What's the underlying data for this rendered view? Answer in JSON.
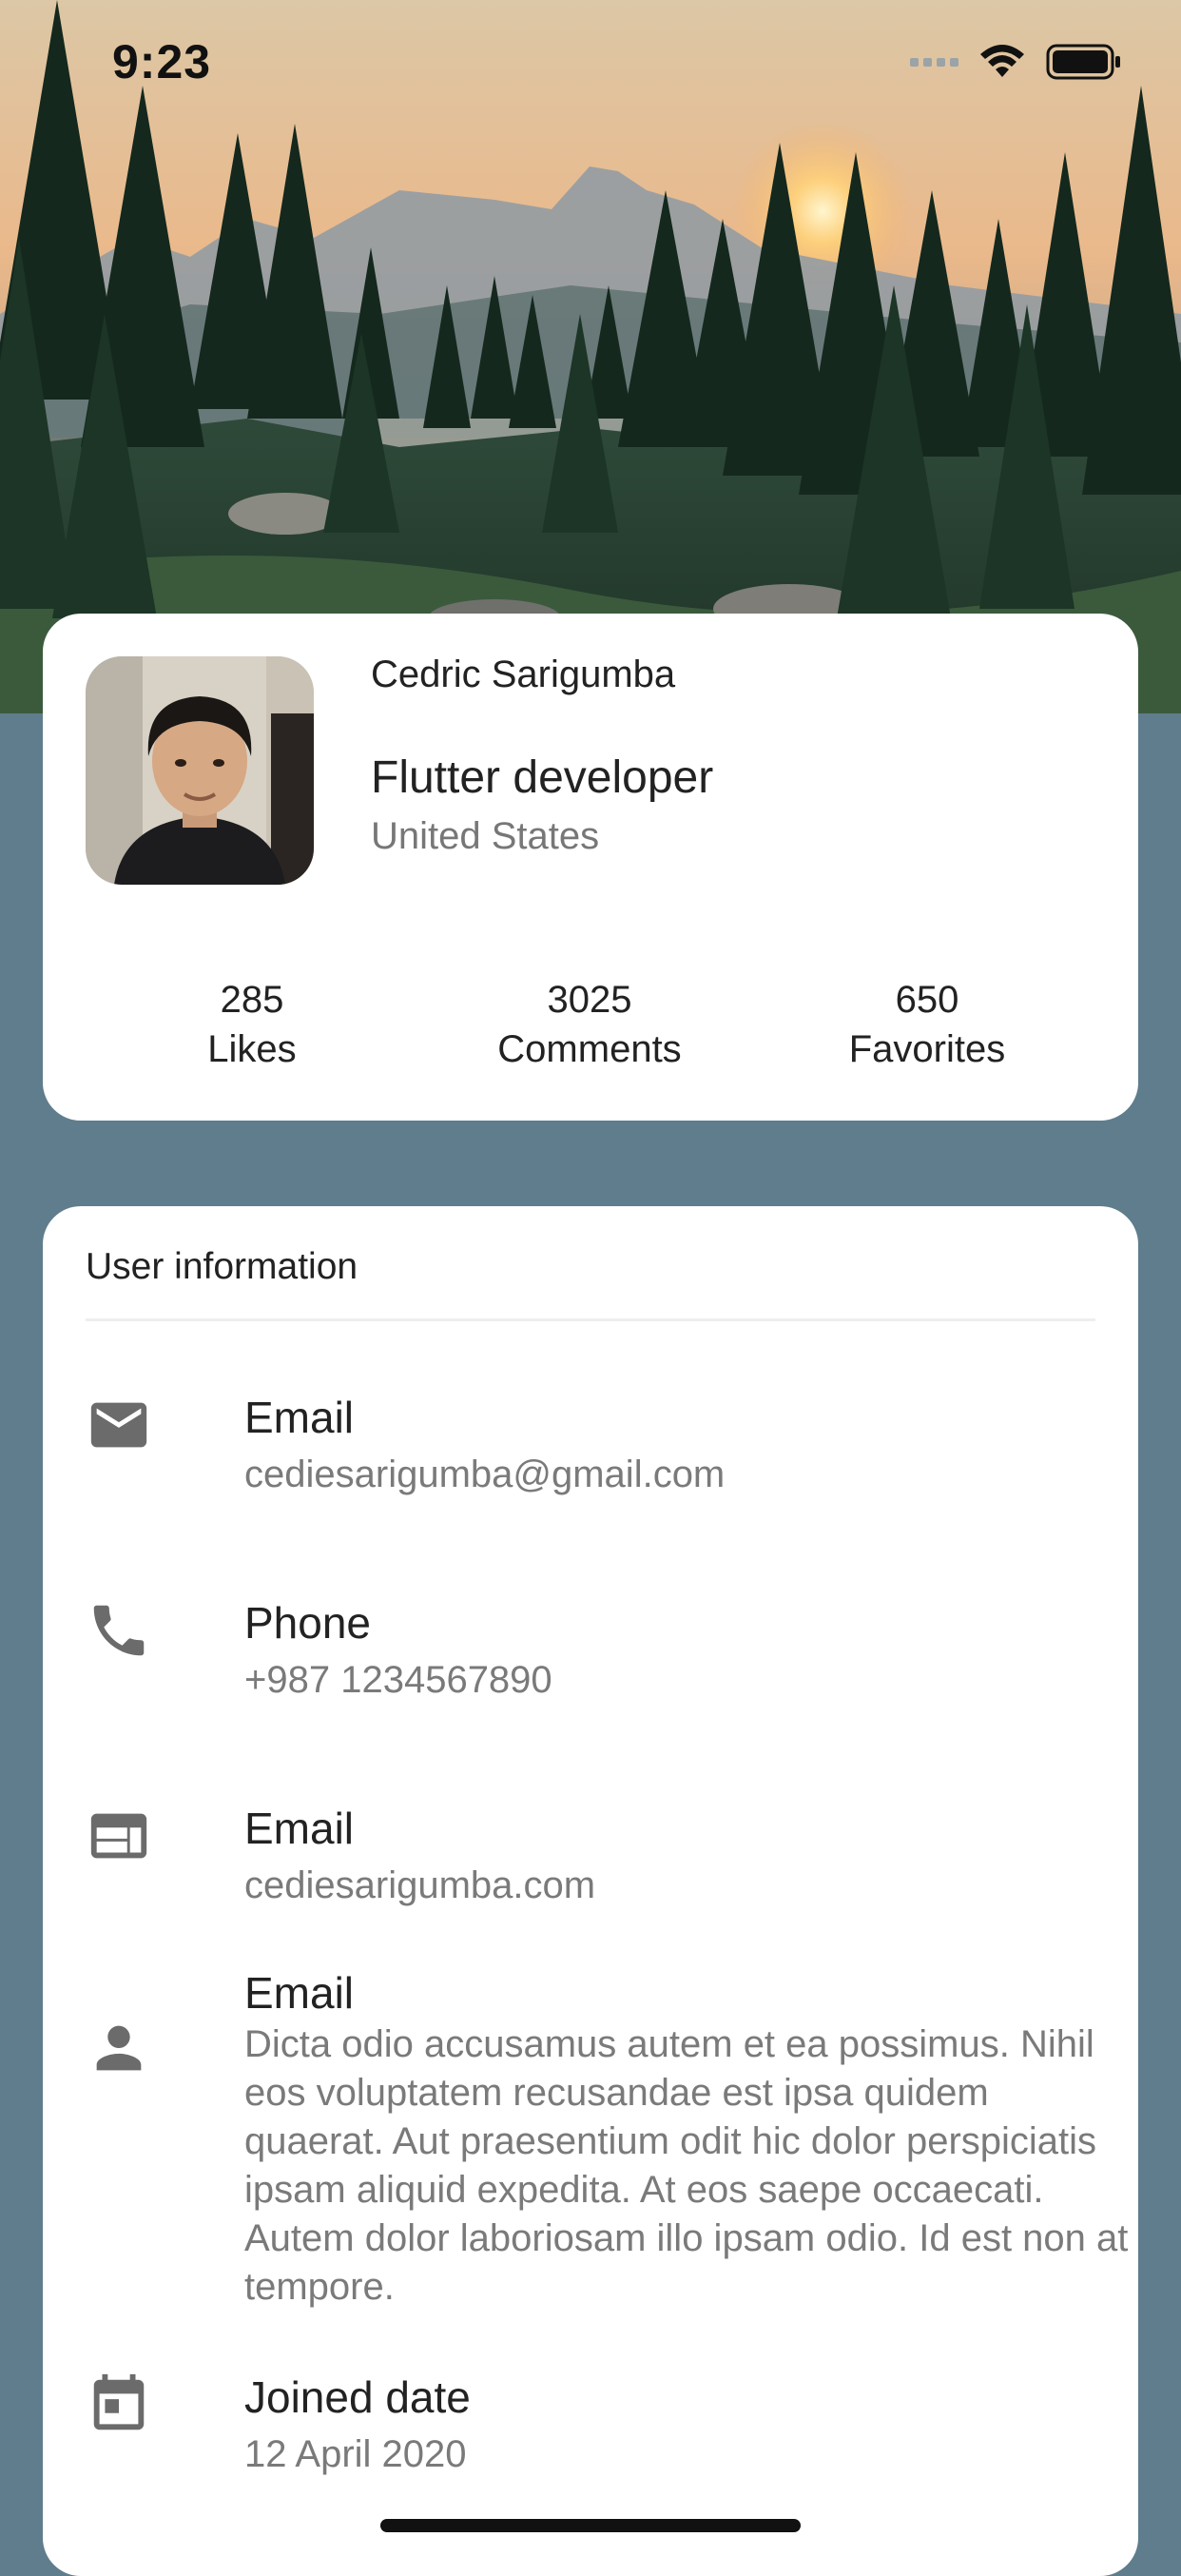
{
  "status_bar": {
    "time": "9:23"
  },
  "profile": {
    "name": "Cedric Sarigumba",
    "title": "Flutter developer",
    "location": "United States",
    "stats": [
      {
        "value": "285",
        "label": "Likes"
      },
      {
        "value": "3025",
        "label": "Comments"
      },
      {
        "value": "650",
        "label": "Favorites"
      }
    ]
  },
  "user_info": {
    "heading": "User information",
    "items": [
      {
        "icon": "email-icon",
        "title": "Email",
        "value": "cediesarigumba@gmail.com"
      },
      {
        "icon": "phone-icon",
        "title": "Phone",
        "value": "+987 1234567890"
      },
      {
        "icon": "web-icon",
        "title": "Email",
        "value": "cediesarigumba.com"
      },
      {
        "icon": "person-icon",
        "title": "Email",
        "value": "Dicta odio accusamus autem et ea possimus. Nihil eos voluptatem recusandae est ipsa quidem quaerat. Aut praesentium odit hic dolor perspiciatis ipsam aliquid expedita. At eos saepe occaecati. Autem dolor laboriosam illo ipsam odio. Id est non at tempore."
      },
      {
        "icon": "calendar-icon",
        "title": "Joined date",
        "value": "12 April 2020"
      }
    ]
  },
  "colors": {
    "background": "#5f7d8c",
    "card": "#ffffff",
    "icon": "#6b6b6b"
  }
}
